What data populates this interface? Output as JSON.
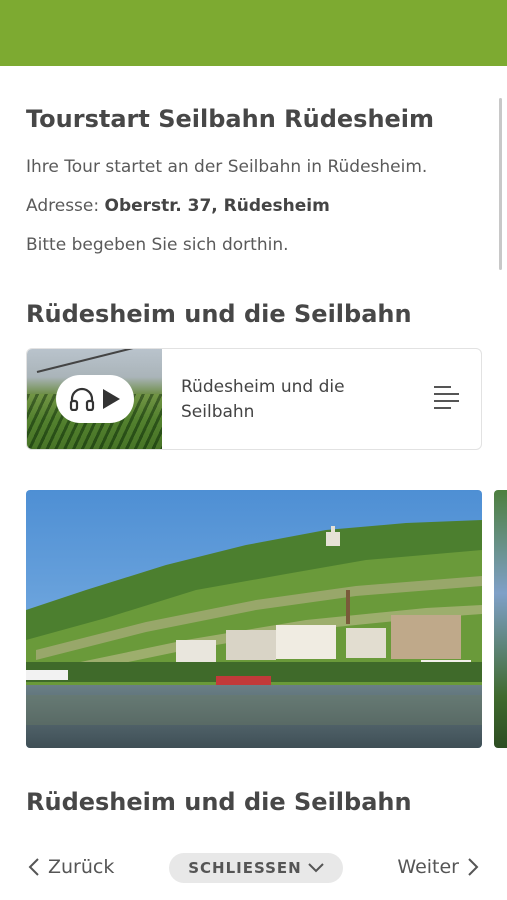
{
  "header": {
    "color": "#7daa31"
  },
  "tourstart": {
    "title": "Tourstart Seilbahn Rüdesheim",
    "intro": "Ihre Tour startet an der Seilbahn in Rüdesheim.",
    "address_label": "Adresse:",
    "address_value": "Oberstr. 37, Rüdesheim",
    "instruction": "Bitte begeben Sie sich dorthin."
  },
  "section1": {
    "title": "Rüdesheim und die Seilbahn",
    "audio_card": {
      "title": "Rüdesheim und die Seilbahn",
      "icons": [
        "headphones-icon",
        "play-icon",
        "list-icon"
      ]
    }
  },
  "section2": {
    "title": "Rüdesheim und die Seilbahn"
  },
  "bottom_nav": {
    "back_label": "Zurück",
    "close_label": "SCHLIESSEN",
    "next_label": "Weiter"
  }
}
